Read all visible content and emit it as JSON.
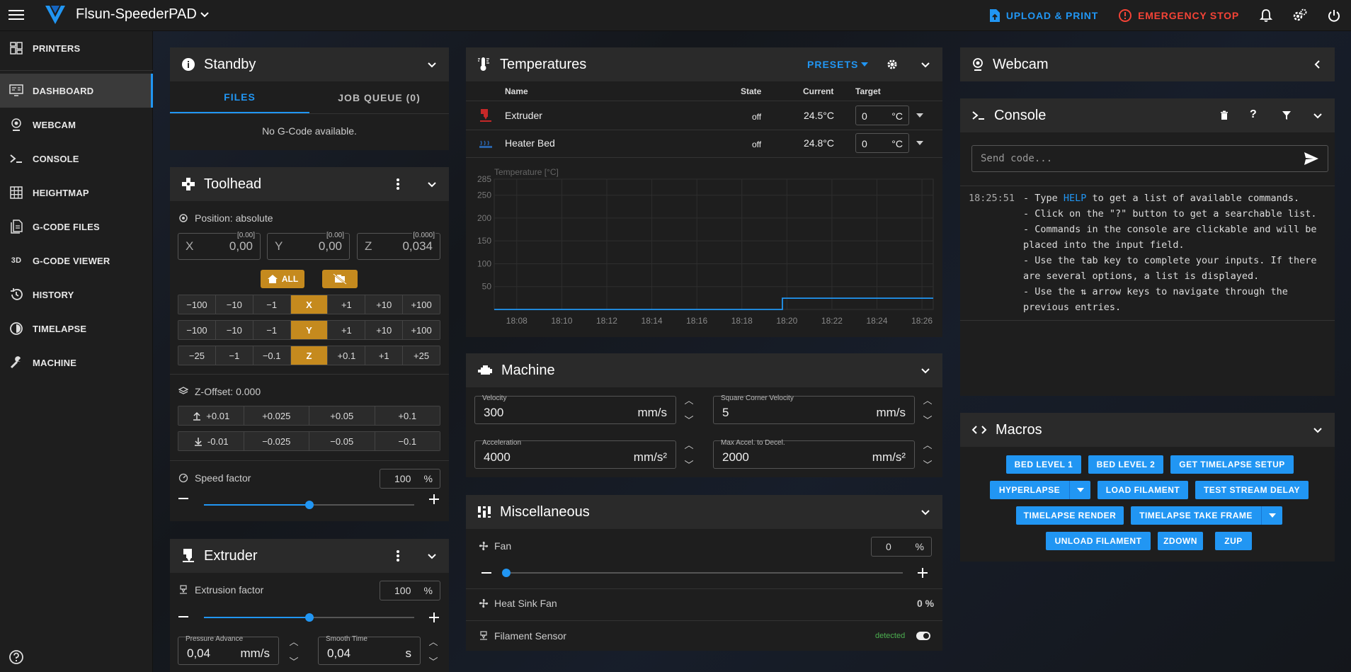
{
  "app": {
    "title": "Flsun-SpeederPAD"
  },
  "topbar": {
    "upload_label": "UPLOAD & PRINT",
    "estop_label": "EMERGENCY STOP"
  },
  "sidebar": {
    "items": [
      {
        "label": "PRINTERS",
        "icon": "printers-icon"
      },
      {
        "label": "DASHBOARD",
        "icon": "dashboard-icon"
      },
      {
        "label": "WEBCAM",
        "icon": "webcam-icon"
      },
      {
        "label": "CONSOLE",
        "icon": "console-icon"
      },
      {
        "label": "HEIGHTMAP",
        "icon": "heightmap-icon"
      },
      {
        "label": "G-CODE FILES",
        "icon": "gcode-files-icon"
      },
      {
        "label": "G-CODE VIEWER",
        "icon": "gcode-viewer-icon"
      },
      {
        "label": "HISTORY",
        "icon": "history-icon"
      },
      {
        "label": "TIMELAPSE",
        "icon": "timelapse-icon"
      },
      {
        "label": "MACHINE",
        "icon": "machine-icon"
      }
    ]
  },
  "standby": {
    "title": "Standby",
    "tabs": [
      "FILES",
      "JOB QUEUE (0)"
    ],
    "empty": "No G-Code available."
  },
  "toolhead": {
    "title": "Toolhead",
    "position_label": "Position: absolute",
    "axes": [
      {
        "label": "X",
        "value": "0,00",
        "sub": "[0.00]"
      },
      {
        "label": "Y",
        "value": "0,00",
        "sub": "[0.00]"
      },
      {
        "label": "Z",
        "value": "0,034",
        "sub": "[0.000]"
      }
    ],
    "home_all_label": "ALL",
    "jog_rows": [
      {
        "axis": "X",
        "minus": [
          "−100",
          "−10",
          "−1"
        ],
        "plus": [
          "+1",
          "+10",
          "+100"
        ]
      },
      {
        "axis": "Y",
        "minus": [
          "−100",
          "−10",
          "−1"
        ],
        "plus": [
          "+1",
          "+10",
          "+100"
        ]
      },
      {
        "axis": "Z",
        "minus": [
          "−25",
          "−1",
          "−0.1"
        ],
        "plus": [
          "+0.1",
          "+1",
          "+25"
        ]
      }
    ],
    "zoffset_label": "Z-Offset: 0.000",
    "zoffset_up": [
      "+0.01",
      "+0.025",
      "+0.05",
      "+0.1"
    ],
    "zoffset_down": [
      "-0.01",
      "−0.025",
      "−0.05",
      "−0.1"
    ],
    "speed_label": "Speed factor",
    "speed_value": "100",
    "speed_unit": "%",
    "speed_slider_fraction": 0.5
  },
  "extruder": {
    "title": "Extruder",
    "factor_label": "Extrusion factor",
    "factor_value": "100",
    "factor_unit": "%",
    "factor_slider_fraction": 0.5,
    "pressure_label": "Pressure Advance",
    "pressure_value": "0,04",
    "pressure_unit": "mm/s",
    "smooth_label": "Smooth Time",
    "smooth_value": "0,04",
    "smooth_unit": "s"
  },
  "temperatures": {
    "title": "Temperatures",
    "presets_label": "PRESETS",
    "headers": {
      "name": "Name",
      "state": "State",
      "current": "Current",
      "target": "Target"
    },
    "rows": [
      {
        "name": "Extruder",
        "state": "off",
        "current": "24.5°C",
        "target": "0",
        "unit": "°C",
        "icon": "extruder-heater-icon"
      },
      {
        "name": "Heater Bed",
        "state": "off",
        "current": "24.8°C",
        "target": "0",
        "unit": "°C",
        "icon": "heater-bed-icon"
      }
    ]
  },
  "chart_data": {
    "type": "line",
    "title": "",
    "ylabel": "Temperature [°C]",
    "xlabel": "",
    "x_ticks": [
      "18:08",
      "18:10",
      "18:12",
      "18:14",
      "18:16",
      "18:18",
      "18:20",
      "18:22",
      "18:24",
      "18:26"
    ],
    "y_ticks": [
      50,
      100,
      150,
      200,
      250,
      285
    ],
    "ylim": [
      0,
      285
    ],
    "grid": true,
    "series": [
      {
        "color": "#2196f3",
        "x": [
          "18:07",
          "18:19.8",
          "18:19.8",
          "18:26.5"
        ],
        "values": [
          0,
          0,
          24.6,
          24.6
        ]
      }
    ]
  },
  "machine": {
    "title": "Machine",
    "fields": [
      {
        "label": "Velocity",
        "value": "300",
        "unit": "mm/s"
      },
      {
        "label": "Square Corner Velocity",
        "value": "5",
        "unit": "mm/s"
      },
      {
        "label": "Acceleration",
        "value": "4000",
        "unit": "mm/s²"
      },
      {
        "label": "Max Accel. to Decel.",
        "value": "2000",
        "unit": "mm/s²"
      }
    ]
  },
  "misc": {
    "title": "Miscellaneous",
    "fan_label": "Fan",
    "fan_value": "0",
    "fan_unit": "%",
    "fan_slider_fraction": 0,
    "heatsink_label": "Heat Sink Fan",
    "heatsink_value": "0 %",
    "sensor_label": "Filament Sensor",
    "sensor_status": "detected"
  },
  "webcam": {
    "title": "Webcam"
  },
  "console": {
    "title": "Console",
    "placeholder": "Send code...",
    "time": "18:25:51",
    "lines": [
      {
        "pre": "- Type ",
        "kw": "HELP",
        "post": " to get a list of available commands."
      },
      {
        "pre": "- Click on the \"?\" button to get a searchable list.",
        "kw": "",
        "post": ""
      },
      {
        "pre": "- Commands in the console are clickable and will be",
        "kw": "",
        "post": ""
      },
      {
        "pre": "placed into the input field.",
        "kw": "",
        "post": ""
      },
      {
        "pre": "- Use the tab key to complete your inputs. If there",
        "kw": "",
        "post": ""
      },
      {
        "pre": "are several options, a list is displayed.",
        "kw": "",
        "post": ""
      },
      {
        "pre": "- Use the ⇅ arrow keys to navigate through the",
        "kw": "",
        "post": ""
      },
      {
        "pre": "previous entries.",
        "kw": "",
        "post": ""
      }
    ]
  },
  "macros": {
    "title": "Macros",
    "buttons": [
      "BED LEVEL 1",
      "BED LEVEL 2",
      "GET TIMELAPSE SETUP",
      "HYPERLAPSE",
      "LOAD FILAMENT",
      "TEST STREAM DELAY",
      "TIMELAPSE RENDER",
      "TIMELAPSE TAKE FRAME",
      "UNLOAD FILAMENT",
      "ZDOWN",
      "ZUP"
    ]
  }
}
